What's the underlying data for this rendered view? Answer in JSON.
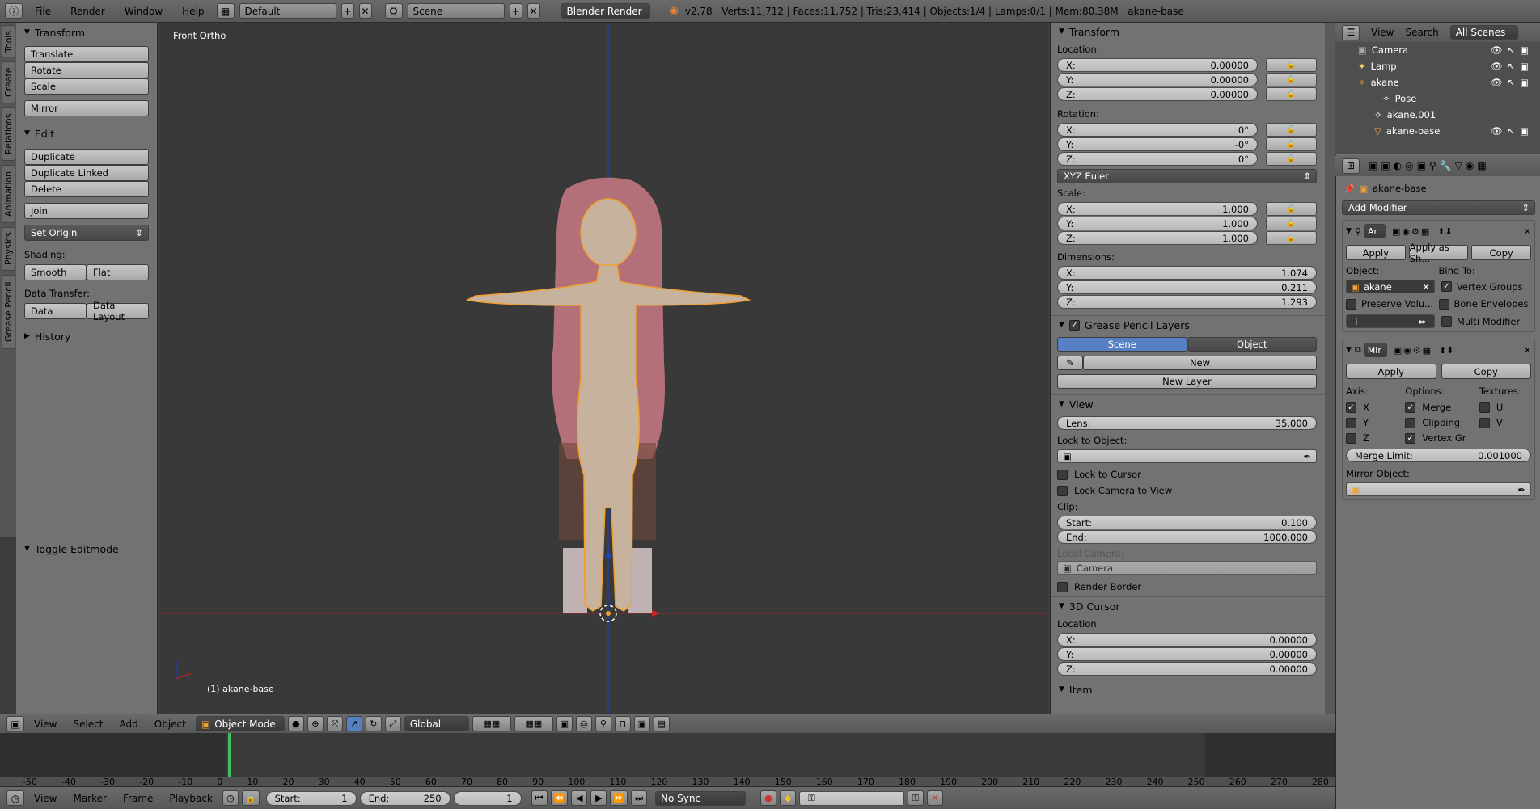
{
  "topbar": {
    "menus": [
      "File",
      "Render",
      "Window",
      "Help"
    ],
    "screen_layout": "Default",
    "scene": "Scene",
    "engine": "Blender Render",
    "info": "v2.78 | Verts:11,712 | Faces:11,752 | Tris:23,414 | Objects:1/4 | Lamps:0/1 | Mem:80.38M | akane-base"
  },
  "tool_tabs": [
    "Tools",
    "Create",
    "Relations",
    "Animation",
    "Physics",
    "Grease Pencil"
  ],
  "toolshelf": {
    "transform_title": "Transform",
    "translate": "Translate",
    "rotate": "Rotate",
    "scale": "Scale",
    "mirror": "Mirror",
    "edit_title": "Edit",
    "duplicate": "Duplicate",
    "duplicate_linked": "Duplicate Linked",
    "delete": "Delete",
    "join": "Join",
    "set_origin": "Set Origin",
    "shading_label": "Shading:",
    "smooth": "Smooth",
    "flat": "Flat",
    "data_transfer_label": "Data Transfer:",
    "data": "Data",
    "data_layout": "Data Layout",
    "history_title": "History",
    "toggle_editmode": "Toggle Editmode"
  },
  "viewport": {
    "view_label": "Front Ortho",
    "object_label": "(1) akane-base"
  },
  "npanel": {
    "transform_title": "Transform",
    "location_label": "Location:",
    "loc_x": "0.00000",
    "loc_y": "0.00000",
    "loc_z": "0.00000",
    "rotation_label": "Rotation:",
    "rot_x": "0°",
    "rot_y": "-0°",
    "rot_z": "0°",
    "rotation_mode": "XYZ Euler",
    "scale_label": "Scale:",
    "scale_x": "1.000",
    "scale_y": "1.000",
    "scale_z": "1.000",
    "dimensions_label": "Dimensions:",
    "dim_x": "1.074",
    "dim_y": "0.211",
    "dim_z": "1.293",
    "gp_title": "Grease Pencil Layers",
    "gp_scene": "Scene",
    "gp_object": "Object",
    "gp_new": "New",
    "gp_new_layer": "New Layer",
    "view_title": "View",
    "lens_label": "Lens:",
    "lens": "35.000",
    "lock_object_label": "Lock to Object:",
    "lock_cursor": "Lock to Cursor",
    "lock_camera": "Lock Camera to View",
    "clip_label": "Clip:",
    "clip_start_label": "Start:",
    "clip_start": "0.100",
    "clip_end_label": "End:",
    "clip_end": "1000.000",
    "local_camera_label": "Local Camera:",
    "local_camera": "Camera",
    "render_border": "Render Border",
    "cursor_title": "3D Cursor",
    "cursor_location_label": "Location:",
    "cur_x": "0.00000",
    "cur_y": "0.00000",
    "cur_z": "0.00000",
    "item_title": "Item"
  },
  "outliner": {
    "view": "View",
    "search": "Search",
    "scenes": "All Scenes",
    "items": [
      "Camera",
      "Lamp",
      "akane",
      "Pose",
      "akane.001",
      "akane-base"
    ]
  },
  "properties": {
    "object_name": "akane-base",
    "add_modifier": "Add Modifier",
    "armature_mod_name": "Ar",
    "apply": "Apply",
    "apply_as_shape": "Apply as Sh...",
    "copy": "Copy",
    "object_label": "Object:",
    "bind_to_label": "Bind To:",
    "object_value": "akane",
    "vertex_groups": "Vertex Groups",
    "preserve_volume": "Preserve Volu...",
    "bone_envelopes": "Bone Envelopes",
    "multi_modifier": "Multi Modifier",
    "mirror_mod_name": "Mir",
    "apply2": "Apply",
    "copy2": "Copy",
    "axis_label": "Axis:",
    "options_label": "Options:",
    "textures_label": "Textures:",
    "axis_x": "X",
    "axis_y": "Y",
    "axis_z": "Z",
    "merge": "Merge",
    "clipping": "Clipping",
    "vertex_gr": "Vertex Gr",
    "tex_u": "U",
    "tex_v": "V",
    "merge_limit_label": "Merge Limit:",
    "merge_limit": "0.001000",
    "mirror_object_label": "Mirror Object:"
  },
  "view_header": {
    "menus": [
      "View",
      "Select",
      "Add",
      "Object"
    ],
    "mode": "Object Mode",
    "orientation": "Global"
  },
  "timeline": {
    "ticks": [
      "-50",
      "-40",
      "-30",
      "-20",
      "-10",
      "0",
      "10",
      "20",
      "30",
      "40",
      "50",
      "60",
      "70",
      "80",
      "90",
      "100",
      "110",
      "120",
      "130",
      "140",
      "150",
      "160",
      "170",
      "180",
      "190",
      "200",
      "210",
      "220",
      "230",
      "240",
      "250",
      "260",
      "270",
      "280"
    ],
    "menus": [
      "View",
      "Marker",
      "Frame",
      "Playback"
    ],
    "start_label": "Start:",
    "start": "1",
    "end_label": "End:",
    "end": "250",
    "current": "1",
    "sync": "No Sync"
  },
  "colors": {
    "accent": "#5680c2",
    "x_axis": "#cc2222",
    "z_axis": "#2040c0",
    "select": "#f0a030"
  }
}
